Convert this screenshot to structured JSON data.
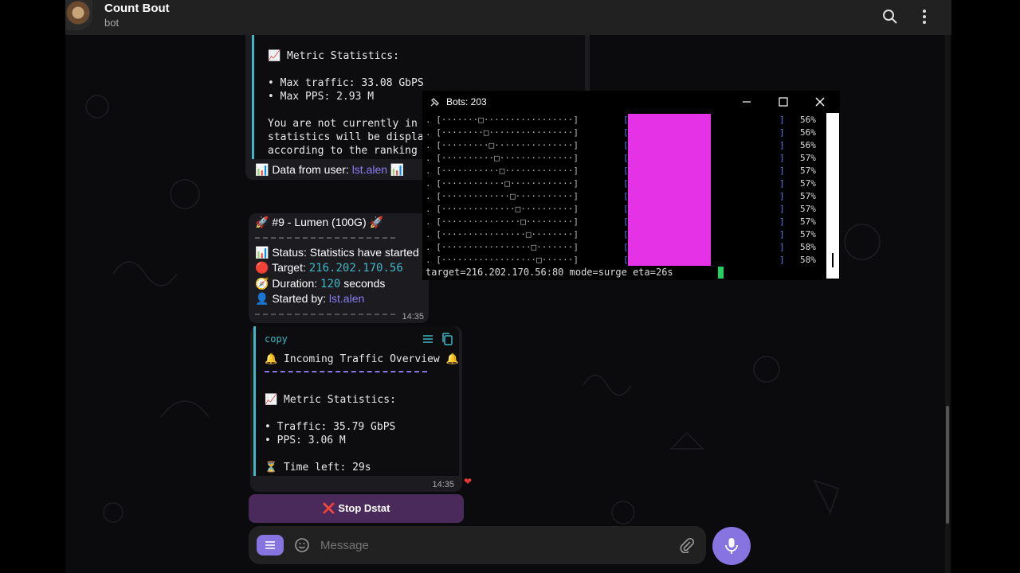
{
  "header": {
    "title": "Count Bout",
    "subtitle": "bot"
  },
  "message1": {
    "lines": [
      "📈 Metric Statistics:",
      "",
      "• Max traffic: 33.08 GbPS",
      "• Max PPS: 2.93 M",
      "",
      "You are not currently in an",
      "statistics will be displaye",
      "according to the ranking of"
    ],
    "footer_prefix": "📊 Data from user: ",
    "footer_user": "lst.alen",
    "footer_suffix": " 📊"
  },
  "message2": {
    "title": "🚀 #9 - Lumen (100G) 🚀",
    "status_label": "📊 Status: ",
    "status_value": "Statistics have started",
    "target_label": "🔴 Target: ",
    "target_value": "216.202.170.56",
    "duration_label": "🧭 Duration: ",
    "duration_value": "120",
    "duration_unit": " seconds",
    "started_label": "👤 Started by: ",
    "started_value": "lst.alen",
    "time": "14:35"
  },
  "message3": {
    "copy_label": "copy",
    "lines": [
      "🔔 Incoming Traffic Overview 🔔",
      "",
      "",
      "📈 Metric Statistics:",
      "",
      "• Traffic: 35.79 GbPS",
      "• PPS: 3.06 M",
      "",
      "⏳ Time left: 29s"
    ],
    "time": "14:35",
    "reaction": "❤"
  },
  "stop_button": {
    "label": "❌ Stop Dstat"
  },
  "composer": {
    "placeholder": "Message"
  },
  "terminal": {
    "title": "Bots: 203",
    "rows": [
      ". [·······□·················]",
      ". [········□················]",
      ". [·········□···············]",
      ". [··········□··············]",
      ". [···········□·············]",
      ". [············□············]",
      ". [·············□···········]",
      ". [··············□··········]",
      ". [···············□·········]",
      ". [················□········]",
      ". [·················□·······]",
      ". [··················□······]"
    ],
    "percents": [
      "56%",
      "56%",
      "56%",
      "57%",
      "57%",
      "57%",
      "57%",
      "57%",
      "57%",
      "57%",
      "58%",
      "58%"
    ],
    "status_line": "target=216.202.170.56:80 mode=surge eta=26s",
    "bar_color": "#e632e6",
    "cursor_color": "#23d160"
  },
  "colors": {
    "accent": "#8774e1",
    "link": "#8b7cf6",
    "mono_highlight": "#3fb7c5",
    "quote_bar": "#3fb7c5"
  }
}
